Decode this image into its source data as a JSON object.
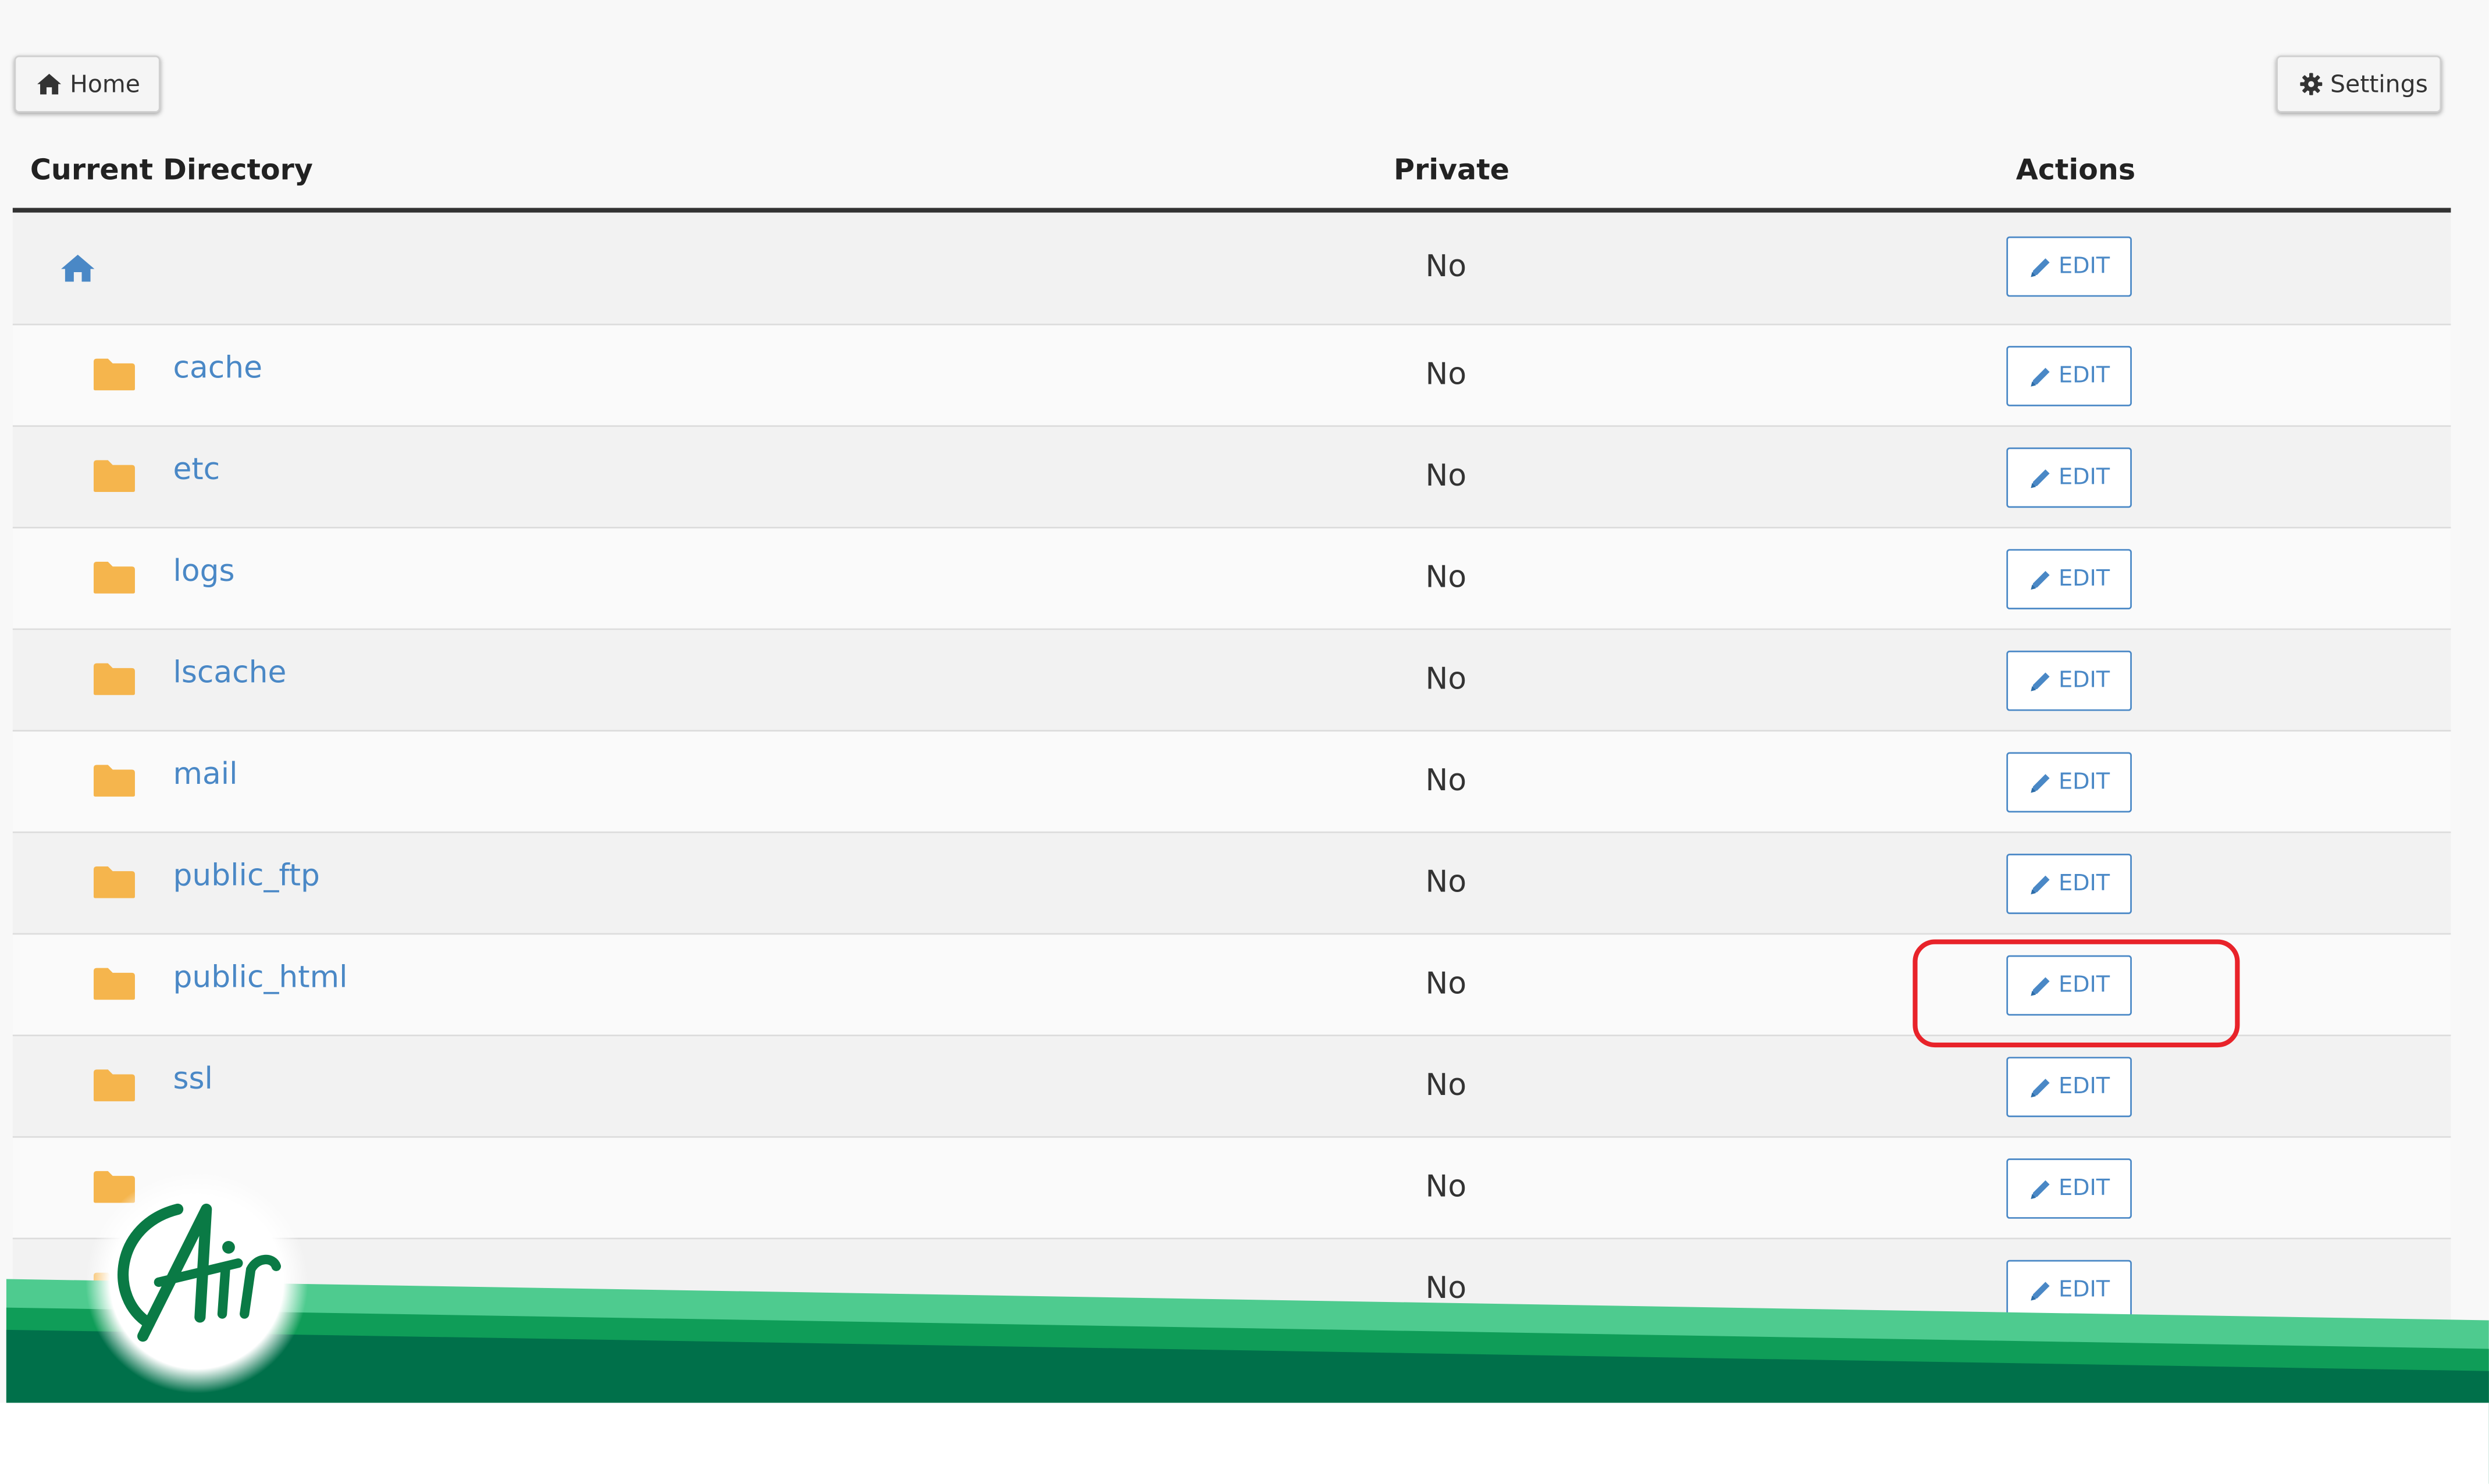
{
  "toolbar": {
    "home_label": "Home",
    "settings_label": "Settings"
  },
  "table": {
    "headers": {
      "directory": "Current Directory",
      "private": "Private",
      "actions": "Actions"
    },
    "edit_label": "EDIT",
    "rows": [
      {
        "name": "",
        "private": "No",
        "icon": "home-icon"
      },
      {
        "name": "cache",
        "private": "No",
        "icon": "folder-icon"
      },
      {
        "name": "etc",
        "private": "No",
        "icon": "folder-icon"
      },
      {
        "name": "logs",
        "private": "No",
        "icon": "folder-icon"
      },
      {
        "name": "lscache",
        "private": "No",
        "icon": "folder-icon"
      },
      {
        "name": "mail",
        "private": "No",
        "icon": "folder-icon"
      },
      {
        "name": "public_ftp",
        "private": "No",
        "icon": "folder-icon"
      },
      {
        "name": "public_html",
        "private": "No",
        "icon": "folder-icon"
      },
      {
        "name": "ssl",
        "private": "No",
        "icon": "folder-icon"
      },
      {
        "name": "",
        "private": "No",
        "icon": "folder-icon"
      },
      {
        "name": "",
        "private": "No",
        "icon": "folder-icon"
      }
    ]
  },
  "annotation": {
    "highlighted_row": "public_html",
    "color": "#e8232a"
  },
  "watermark": {
    "logo_text": "Air",
    "colors": [
      "#4ecb8f",
      "#0f9d58",
      "#00704a"
    ]
  },
  "colors": {
    "link": "#4a88c6",
    "folder": "#f5b54d"
  }
}
